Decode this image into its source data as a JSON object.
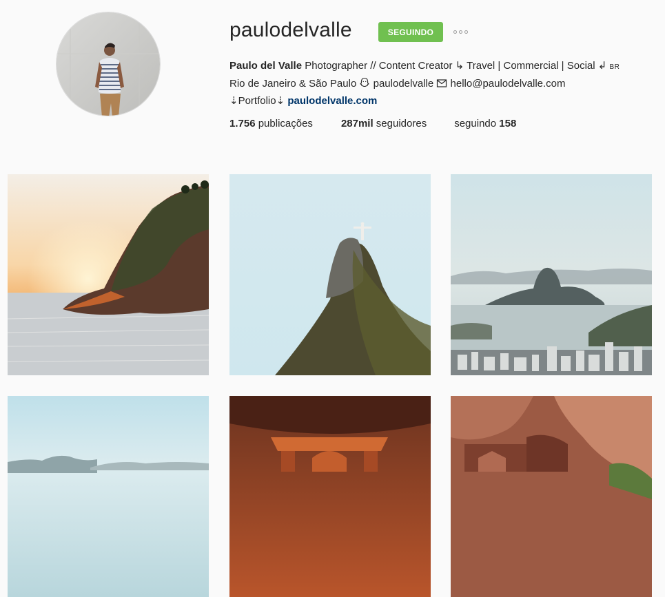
{
  "profile": {
    "username": "paulodelvalle",
    "follow_button_label": "SEGUINDO",
    "more_options_icon": "ellipsis-icon",
    "avatar_icon": "profile-photo",
    "bio": {
      "full_name": "Paulo del Valle",
      "line1_rest": " Photographer // Content Creator ↳ Travel | Commercial | Social ↲ ",
      "country_flag_text": "BR",
      "line2_location": "Rio de Janeiro & São Paulo ",
      "snapchat_icon": "ghost-icon",
      "line2_snapchat": " paulodelvalle ",
      "email_icon": "envelope-icon",
      "line2_email": " hello@paulodelvalle.com",
      "line3_prefix": "⇣Portfolio⇣ ",
      "website": "paulodelvalle.com"
    },
    "stats": {
      "posts_count": "1.756",
      "posts_label": " publicações",
      "followers_count": "287mil",
      "followers_label": " seguidores",
      "following_label": "seguindo ",
      "following_count": "158"
    }
  },
  "colors": {
    "accent_green": "#70c050",
    "link_blue": "#003569",
    "background": "#fafafa"
  },
  "posts": [
    {
      "subject": "sunset-rock-photo"
    },
    {
      "subject": "christ-redeemer-photo"
    },
    {
      "subject": "rio-bay-photo"
    },
    {
      "subject": "coast-mountains-photo"
    },
    {
      "subject": "petra-facade-photo"
    },
    {
      "subject": "petra-cliff-photo"
    }
  ]
}
